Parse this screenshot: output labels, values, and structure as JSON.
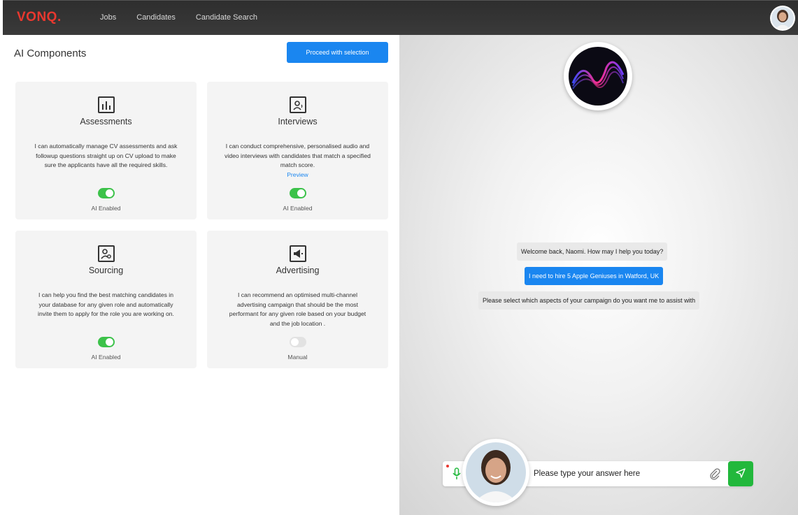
{
  "header": {
    "logo": "VONQ",
    "logo_dot": ".",
    "nav": [
      "Jobs",
      "Candidates",
      "Candidate Search"
    ]
  },
  "left": {
    "title": "AI Components",
    "proceed_label": "Proceed with selection",
    "cards": [
      {
        "title": "Assessments",
        "icon": "bar-chart-icon",
        "desc": "I can automatically manage CV assessments and ask followup questions straight up on CV upload to make sure the applicants have all the required skills.",
        "enabled": true,
        "state": "AI Enabled"
      },
      {
        "title": "Interviews",
        "icon": "interview-icon",
        "desc": "I can conduct comprehensive, personalised audio and video interviews with candidates that match a specified match score.",
        "link": "Preview",
        "enabled": true,
        "state": "AI Enabled"
      },
      {
        "title": "Sourcing",
        "icon": "sourcing-icon",
        "desc": "I can help you find the best matching candidates in your database for any given role and automatically invite them to apply for the role you are working on.",
        "enabled": true,
        "state": "AI Enabled"
      },
      {
        "title": "Advertising",
        "icon": "megaphone-icon",
        "desc": "I can recommend an optimised multi-channel advertising campaign that should be the most performant for any given role based on your budget and the job location .",
        "enabled": false,
        "state": "Manual"
      }
    ]
  },
  "chat": {
    "messages": [
      {
        "from": "bot",
        "text": "Welcome back, Naomi. How may I help you today?"
      },
      {
        "from": "user",
        "text": "I need to hire 5 Apple Geniuses in Watford, UK"
      },
      {
        "from": "bot",
        "text": "Please select which aspects of your campaign do you want me to assist with"
      }
    ],
    "input_placeholder": "Please type your answer here"
  },
  "colors": {
    "accent": "#1a86f0",
    "brand": "#e8382f",
    "toggle_on": "#3cc24a",
    "send": "#22b83c"
  }
}
